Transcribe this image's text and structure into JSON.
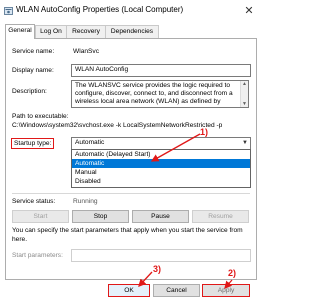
{
  "window": {
    "title": "WLAN AutoConfig Properties (Local Computer)",
    "close_glyph": "✕",
    "icon": "gear-icon"
  },
  "tabs": [
    "General",
    "Log On",
    "Recovery",
    "Dependencies"
  ],
  "general": {
    "service_name_label": "Service name:",
    "service_name_value": "WlanSvc",
    "display_name_label": "Display name:",
    "display_name_value": "WLAN AutoConfig",
    "description_label": "Description:",
    "description_value": "The WLANSVC service provides the logic required to configure, discover, connect to, and disconnect from a wireless local area network (WLAN) as defined by",
    "path_label": "Path to executable:",
    "path_value": "C:\\Windows\\system32\\svchost.exe -k LocalSystemNetworkRestricted -p",
    "startup_type_label": "Startup type:",
    "startup_type_value": "Automatic",
    "startup_options": [
      "Automatic (Delayed Start)",
      "Automatic",
      "Manual",
      "Disabled"
    ],
    "service_status_label": "Service status:",
    "service_status_value": "Running",
    "buttons": {
      "start": "Start",
      "stop": "Stop",
      "pause": "Pause",
      "resume": "Resume"
    },
    "help_text": "You can specify the start parameters that apply when you start the service from here.",
    "start_params_label": "Start parameters:",
    "start_params_value": ""
  },
  "footer": {
    "ok": "OK",
    "cancel": "Cancel",
    "apply": "Apply"
  },
  "annotations": {
    "step1": "1)",
    "step2": "2)",
    "step3": "3)"
  },
  "colors": {
    "accent": "#0078d7",
    "annotation": "#e01818"
  }
}
